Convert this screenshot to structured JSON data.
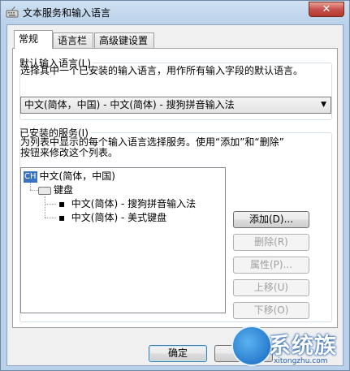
{
  "window": {
    "title": "文本服务和输入语言",
    "close_glyph": "✕"
  },
  "tabs": [
    {
      "label": "常规",
      "active": true
    },
    {
      "label": "语言栏",
      "active": false
    },
    {
      "label": "高级键设置",
      "active": false
    }
  ],
  "default_lang": {
    "group_title": "默认输入语言(L)",
    "description": "选择其中一个已安装的输入语言，用作所有输入字段的默认语言。",
    "selected": "中文(简体，中国) - 中文(简体) - 搜狗拼音输入法"
  },
  "installed": {
    "group_title": "已安装的服务(I)",
    "description_line1": "为列表中显示的每个输入语言选择服务。使用“添加”和“删除”",
    "description_line2": "按钮来修改这个列表。",
    "tree": {
      "lang_badge": "CH",
      "language": "中文(简体，中国)",
      "category": "键盘",
      "items": [
        "中文(简体) - 搜狗拼音输入法",
        "中文(简体) - 美式键盘"
      ]
    },
    "buttons": {
      "add": "添加(D)...",
      "remove": "删除(R)",
      "properties": "属性(P)...",
      "move_up": "上移(U)",
      "move_down": "下移(O)"
    }
  },
  "footer": {
    "ok": "确定"
  },
  "watermark": {
    "title": "系统族",
    "url": "xitongzhu.com"
  },
  "colors": {
    "accent": "#3a72c4",
    "close": "#c75050"
  }
}
